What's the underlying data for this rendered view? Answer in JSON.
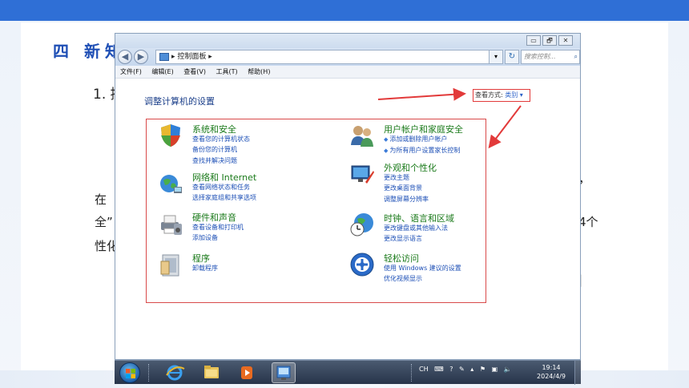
{
  "slide": {
    "section_title": "四 新知",
    "num_line": "1. 控",
    "left_line1": "在",
    "left_line2": "全”",
    "left_line3": "性化",
    "right_line1": "，",
    "right_line2": "4个",
    "right_line3": "|"
  },
  "window": {
    "controls": {
      "minimize": "▭",
      "maximize": "🗗",
      "close": "✕"
    },
    "nav": {
      "back": "◀",
      "forward": "▶"
    },
    "address": {
      "path": "▸ 控制面板 ▸",
      "dropdown": "▾",
      "refresh": "↻"
    },
    "search": {
      "placeholder": "搜索控制...",
      "icon": "⌕"
    },
    "menu": [
      "文件(F)",
      "编辑(E)",
      "查看(V)",
      "工具(T)",
      "帮助(H)"
    ],
    "heading": "调整计算机的设置",
    "view_by": {
      "label": "查看方式:",
      "value": "类别",
      "caret": "▾"
    },
    "categories": [
      {
        "title": "系统和安全",
        "icon": "shield-icon",
        "links": [
          "查看您的计算机状态",
          "备份您的计算机",
          "查找并解决问题"
        ]
      },
      {
        "title": "网络和 Internet",
        "icon": "network-icon",
        "links": [
          "查看网络状态和任务",
          "选择家庭组和共享选项"
        ]
      },
      {
        "title": "硬件和声音",
        "icon": "printer-icon",
        "links": [
          "查看设备和打印机",
          "添加设备"
        ]
      },
      {
        "title": "程序",
        "icon": "programs-icon",
        "links": [
          "卸载程序"
        ]
      },
      {
        "title": "用户帐户和家庭安全",
        "icon": "users-icon",
        "links": [
          "添加或删除用户帐户",
          "为所有用户设置家长控制"
        ]
      },
      {
        "title": "外观和个性化",
        "icon": "appearance-icon",
        "links": [
          "更改主题",
          "更改桌面背景",
          "调整屏幕分辨率"
        ]
      },
      {
        "title": "时钟、语言和区域",
        "icon": "clock-globe-icon",
        "links": [
          "更改键盘或其他输入法",
          "更改显示语言"
        ]
      },
      {
        "title": "轻松访问",
        "icon": "ease-of-access-icon",
        "links": [
          "使用 Windows 建议的设置",
          "优化视频显示"
        ]
      }
    ]
  },
  "taskbar": {
    "tray": {
      "lang": "CH",
      "help": "?"
    },
    "time": "19:14",
    "date": "2024/4/9"
  },
  "colors": {
    "accent_red": "#e23a3a",
    "link_blue": "#1c4fb6",
    "category_green": "#1a7a1a",
    "slide_blue": "#2f6fd6"
  }
}
